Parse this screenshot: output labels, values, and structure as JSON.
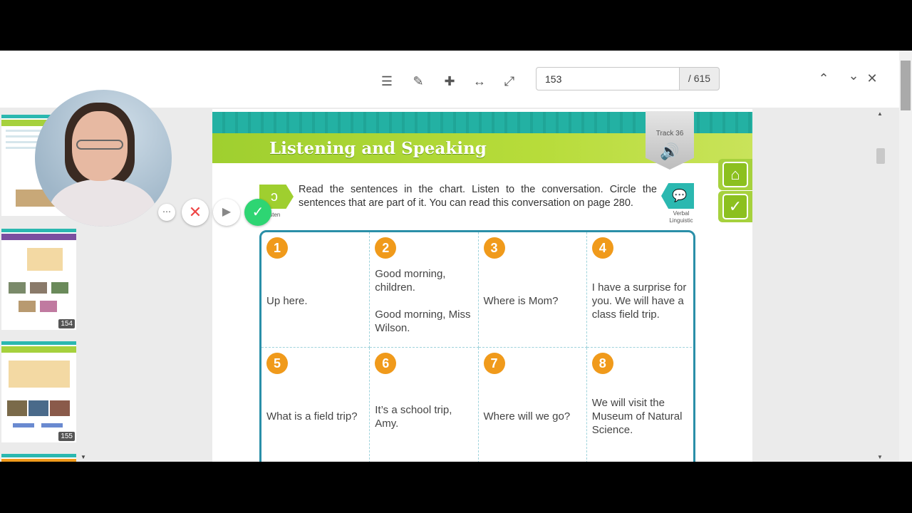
{
  "toolbar": {
    "icons": [
      "list-icon",
      "magic-wand-icon",
      "puzzle-icon",
      "fit-width-icon",
      "fullscreen-icon"
    ],
    "page_value": "153",
    "page_total": "/ 615",
    "nav": [
      "chevron-up-icon",
      "chevron-down-icon",
      "close-icon"
    ]
  },
  "thumbnails": [
    {
      "page": ""
    },
    {
      "page": "154"
    },
    {
      "page": "155"
    }
  ],
  "lesson": {
    "title": "Listening and Speaking",
    "track": "Track 36",
    "listen_caption": "Listen",
    "instructions": "Read the sentences in the chart. Listen to the conversation. Circle the sentences that are part of it. You can read this conversation on page 280.",
    "verbal_caption": "Verbal\nLinguistic"
  },
  "chart": {
    "cells": [
      {
        "n": "1",
        "text": "Up here."
      },
      {
        "n": "2",
        "text": "Good morning, children.\n\nGood morning, Miss Wilson."
      },
      {
        "n": "3",
        "text": "Where is Mom?"
      },
      {
        "n": "4",
        "text": "I have a surprise for you. We will have a class field trip."
      },
      {
        "n": "5",
        "text": "What is a field trip?"
      },
      {
        "n": "6",
        "text": "It’s a school trip, Amy."
      },
      {
        "n": "7",
        "text": "Where will we go?"
      },
      {
        "n": "8",
        "text": "We will visit the Museum of Natural Science."
      }
    ]
  },
  "colors": {
    "teal": "#23b1a3",
    "green": "#a6d13d",
    "orange": "#f09a1b",
    "chart_border": "#2a8fa8",
    "ok_button": "#2ed573"
  }
}
